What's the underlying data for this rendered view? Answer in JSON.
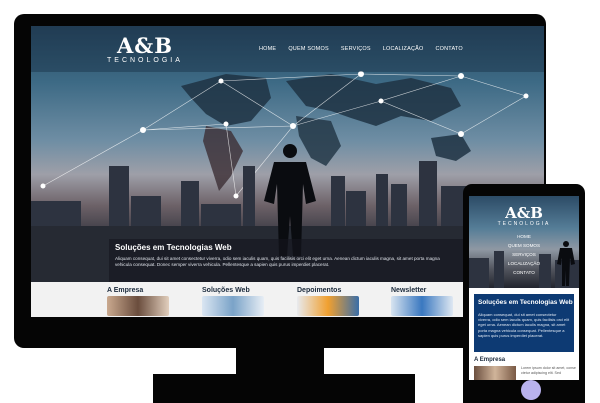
{
  "site": {
    "logo_main": "A&B",
    "logo_sub": "TECNOLOGIA",
    "nav": [
      "HOME",
      "QUEM SOMOS",
      "SERVIÇOS",
      "LOCALIZAÇÃO",
      "CONTATO"
    ],
    "hero_title": "Soluções em Tecnologias Web",
    "hero_text": "Aliquam consequat, dui sit amet consectetur viverra, odio sem iaculis quam, quis facilisis orci elit eget urna. Aenean dictum iaculis magna, sit amet porta magna vehicula consequat. Donec semper viverra vehicula. Pellentesque a sapien quis purus imperdiet placerat.",
    "sections": [
      "A Empresa",
      "Soluções Web",
      "Depoimentos",
      "Newsletter"
    ]
  },
  "mobile": {
    "box_text": "Aliquam consequat, dui sit amet consectetur viverra, odio sem iaculis quam, quis facilisis orci elit eget urna. Aenean dictum iaculis magna, sit amet porta magna vehicula consequat. Pellentesque a sapien quis purus imperdiet placerat.",
    "company_text": "Lorem ipsum dolor sit amet, conse ctetur adipiscing elit. Sed"
  },
  "colors": {
    "device": "#050505",
    "accent_blue": "#0d3a73",
    "home_button": "#b9b2ee"
  }
}
